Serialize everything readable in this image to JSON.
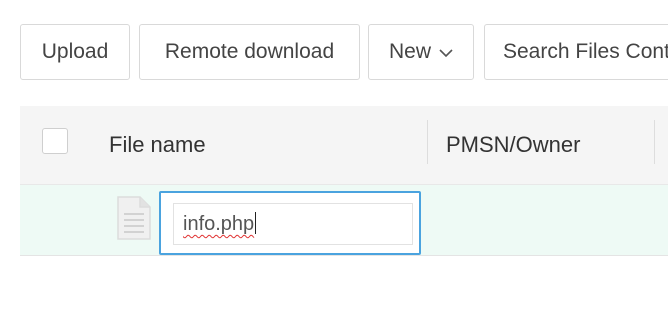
{
  "toolbar": {
    "upload_label": "Upload",
    "remote_download_label": "Remote download",
    "new_label": "New",
    "search_label": "Search Files Content"
  },
  "table": {
    "columns": [
      "File name",
      "PMSN/Owner"
    ],
    "rows": [
      {
        "file_name": "info.php",
        "editing": true
      }
    ]
  },
  "icons": {
    "new_dropdown": "chevron-down-icon",
    "file": "file-icon"
  },
  "colors": {
    "rename_border": "#4aa3df",
    "row_highlight": "#eefaf5",
    "header_bg": "#f5f5f5"
  }
}
